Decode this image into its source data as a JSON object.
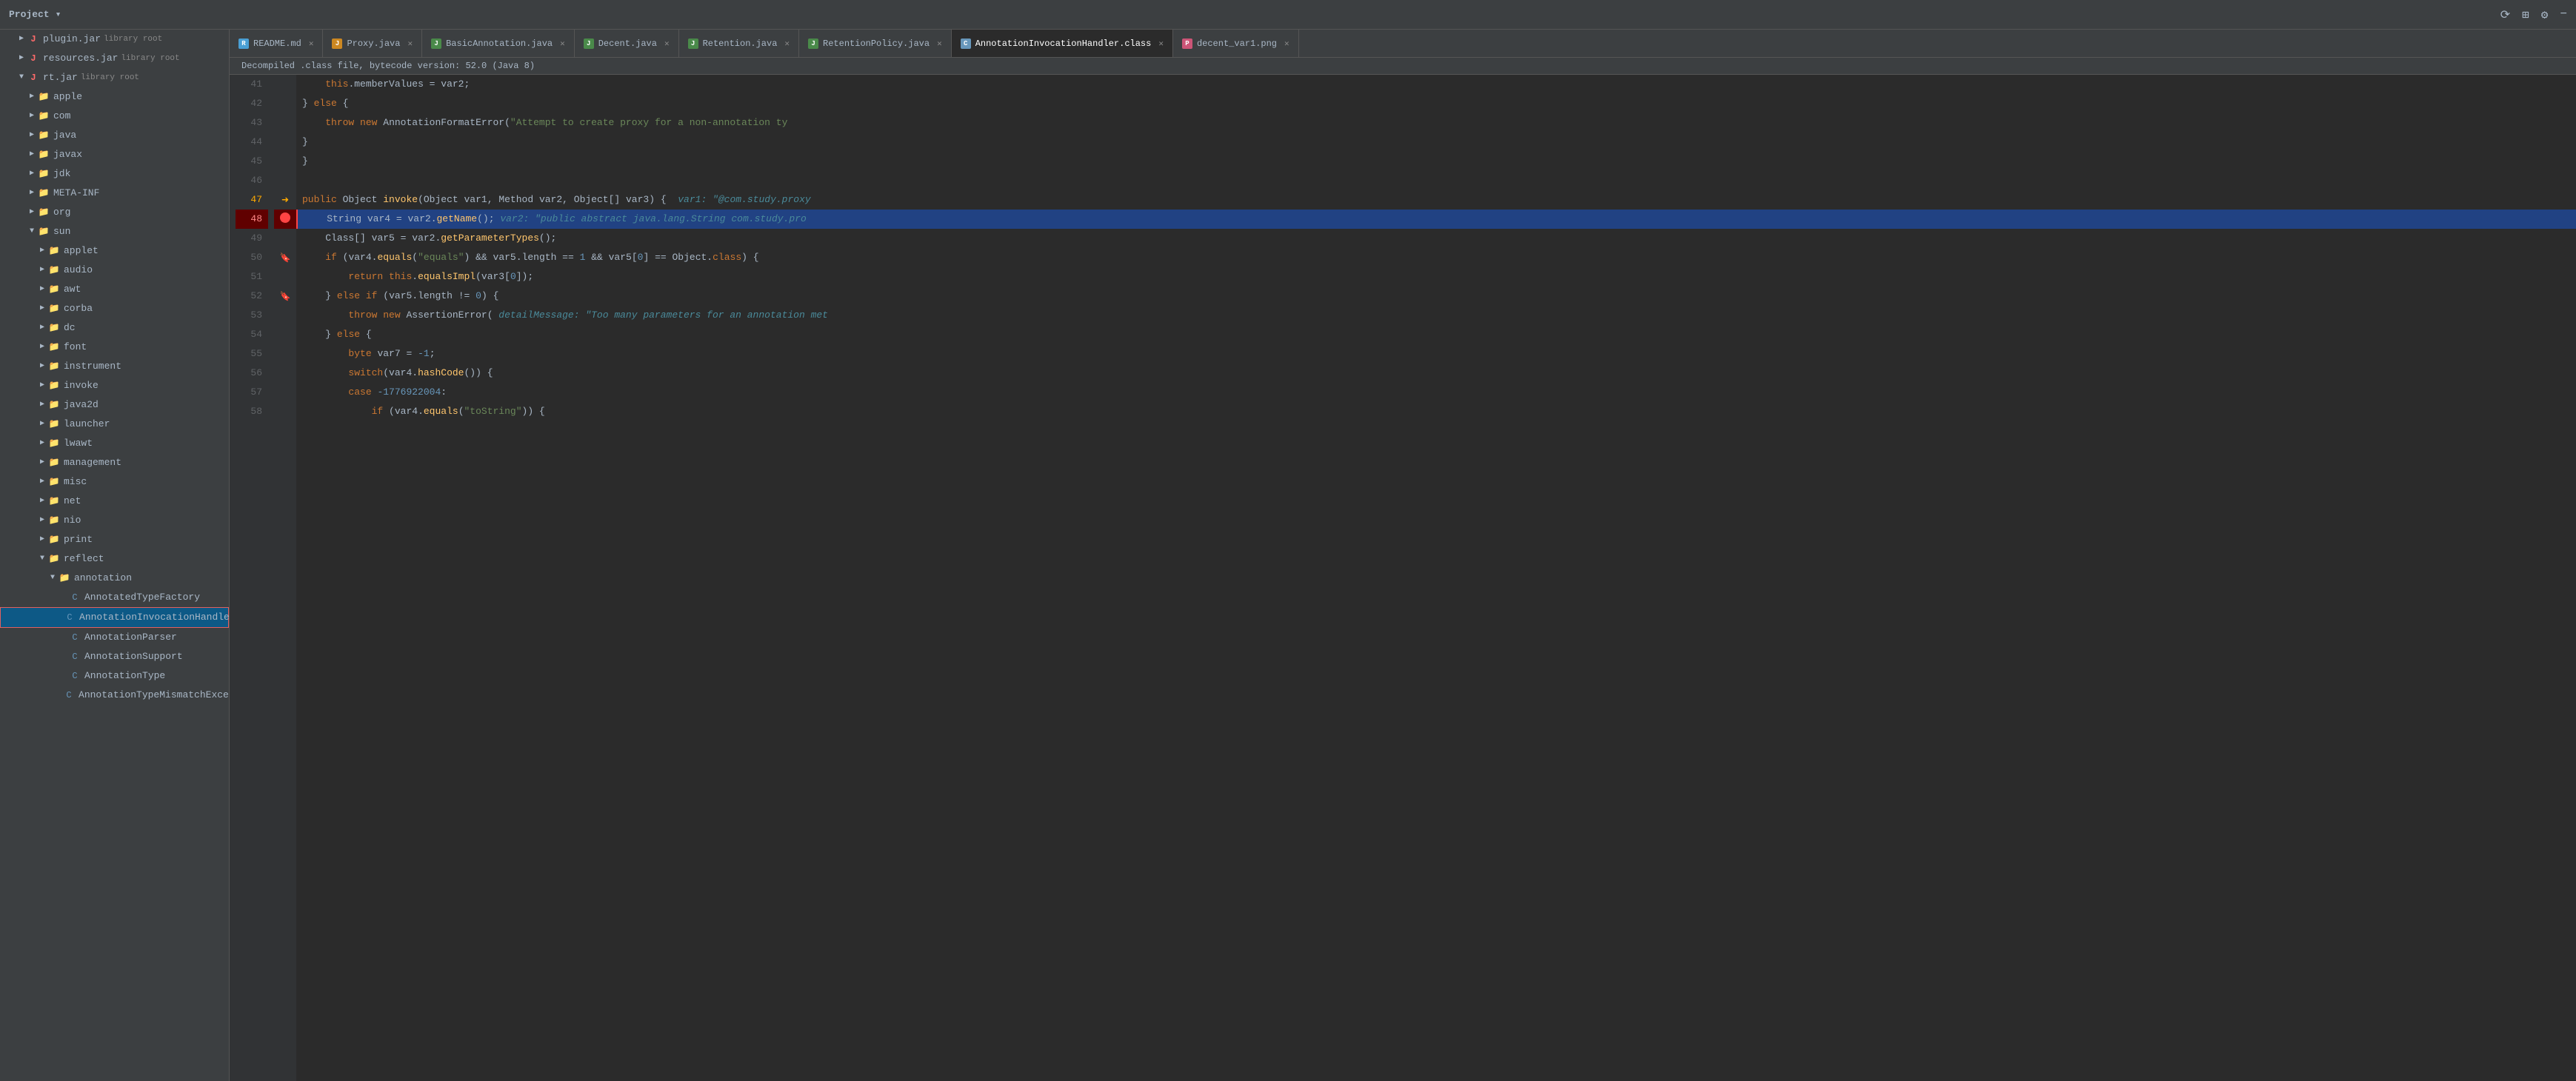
{
  "titlebar": {
    "project_label": "Project",
    "icons": [
      "synchronize",
      "settings",
      "options",
      "minimize"
    ]
  },
  "tabs": [
    {
      "id": "readme",
      "label": "README.md",
      "icon": "readme",
      "active": false,
      "closeable": true
    },
    {
      "id": "proxy",
      "label": "Proxy.java",
      "icon": "java",
      "active": false,
      "closeable": true
    },
    {
      "id": "basic",
      "label": "BasicAnnotation.java",
      "icon": "java-green",
      "active": false,
      "closeable": true
    },
    {
      "id": "decent",
      "label": "Decent.java",
      "icon": "java-green",
      "active": false,
      "closeable": true
    },
    {
      "id": "retention",
      "label": "Retention.java",
      "icon": "java-green",
      "active": false,
      "closeable": true
    },
    {
      "id": "retentionpolicy",
      "label": "RetentionPolicy.java",
      "icon": "java-green",
      "active": false,
      "closeable": true
    },
    {
      "id": "annotationhandler",
      "label": "AnnotationInvocationHandler.class",
      "icon": "class",
      "active": true,
      "closeable": true
    },
    {
      "id": "decent_var",
      "label": "decent_var1.png",
      "icon": "png",
      "active": false,
      "closeable": true
    }
  ],
  "decompile_notice": "Decompiled .class file, bytecode version: 52.0 (Java 8)",
  "sidebar": {
    "items": [
      {
        "label": "plugin.jar",
        "sublabel": "library root",
        "level": 1,
        "type": "jar",
        "expanded": false
      },
      {
        "label": "resources.jar",
        "sublabel": "library root",
        "level": 1,
        "type": "jar",
        "expanded": false
      },
      {
        "label": "rt.jar",
        "sublabel": "library root",
        "level": 1,
        "type": "jar",
        "expanded": true
      },
      {
        "label": "apple",
        "level": 2,
        "type": "folder",
        "expanded": false
      },
      {
        "label": "com",
        "level": 2,
        "type": "folder",
        "expanded": false
      },
      {
        "label": "java",
        "level": 2,
        "type": "folder",
        "expanded": false
      },
      {
        "label": "javax",
        "level": 2,
        "type": "folder",
        "expanded": false
      },
      {
        "label": "jdk",
        "level": 2,
        "type": "folder",
        "expanded": false
      },
      {
        "label": "META-INF",
        "level": 2,
        "type": "folder",
        "expanded": false
      },
      {
        "label": "org",
        "level": 2,
        "type": "folder",
        "expanded": false
      },
      {
        "label": "sun",
        "level": 2,
        "type": "folder",
        "expanded": true
      },
      {
        "label": "applet",
        "level": 3,
        "type": "folder",
        "expanded": false
      },
      {
        "label": "audio",
        "level": 3,
        "type": "folder",
        "expanded": false
      },
      {
        "label": "awt",
        "level": 3,
        "type": "folder",
        "expanded": false
      },
      {
        "label": "corba",
        "level": 3,
        "type": "folder",
        "expanded": false
      },
      {
        "label": "dc",
        "level": 3,
        "type": "folder",
        "expanded": false
      },
      {
        "label": "font",
        "level": 3,
        "type": "folder",
        "expanded": false
      },
      {
        "label": "instrument",
        "level": 3,
        "type": "folder",
        "expanded": false
      },
      {
        "label": "invoke",
        "level": 3,
        "type": "folder",
        "expanded": false
      },
      {
        "label": "java2d",
        "level": 3,
        "type": "folder",
        "expanded": false
      },
      {
        "label": "launcher",
        "level": 3,
        "type": "folder",
        "expanded": false
      },
      {
        "label": "lwawt",
        "level": 3,
        "type": "folder",
        "expanded": false
      },
      {
        "label": "management",
        "level": 3,
        "type": "folder",
        "expanded": false
      },
      {
        "label": "misc",
        "level": 3,
        "type": "folder",
        "expanded": false
      },
      {
        "label": "net",
        "level": 3,
        "type": "folder",
        "expanded": false
      },
      {
        "label": "nio",
        "level": 3,
        "type": "folder",
        "expanded": false
      },
      {
        "label": "print",
        "level": 3,
        "type": "folder",
        "expanded": false
      },
      {
        "label": "reflect",
        "level": 3,
        "type": "folder",
        "expanded": true
      },
      {
        "label": "annotation",
        "level": 4,
        "type": "folder",
        "expanded": true
      },
      {
        "label": "AnnotatedTypeFactory",
        "level": 5,
        "type": "class"
      },
      {
        "label": "AnnotationInvocationHandler",
        "level": 5,
        "type": "class",
        "selected": true
      },
      {
        "label": "AnnotationParser",
        "level": 5,
        "type": "class"
      },
      {
        "label": "AnnotationSupport",
        "level": 5,
        "type": "class"
      },
      {
        "label": "AnnotationType",
        "level": 5,
        "type": "class"
      },
      {
        "label": "AnnotationTypeMismatchExcepti...",
        "level": 5,
        "type": "class"
      }
    ]
  },
  "code": {
    "lines": [
      {
        "num": 41,
        "content": "    this.memberValues = var2;",
        "gutter": ""
      },
      {
        "num": 42,
        "content": "} else {",
        "gutter": ""
      },
      {
        "num": 43,
        "content": "    throw new AnnotationFormatError(\"Attempt to create proxy for a non-annotation ty",
        "gutter": ""
      },
      {
        "num": 44,
        "content": "}",
        "gutter": ""
      },
      {
        "num": 45,
        "content": "}",
        "gutter": ""
      },
      {
        "num": 46,
        "content": "",
        "gutter": ""
      },
      {
        "num": 47,
        "content": "public Object invoke(Object var1, Method var2, Object[] var3) {",
        "gutter": "arrow",
        "hint": "var1: \"@com.study.proxy"
      },
      {
        "num": 48,
        "content": "    String var4 = var2.getName();",
        "gutter": "breakpoint",
        "hint": "var2: \"public abstract java.lang.String com.study.pro",
        "selected": true
      },
      {
        "num": 49,
        "content": "    Class[] var5 = var2.getParameterTypes();",
        "gutter": ""
      },
      {
        "num": 50,
        "content": "    if (var4.equals(\"equals\") && var5.length == 1 && var5[0] == Object.class) {",
        "gutter": "bookmark"
      },
      {
        "num": 51,
        "content": "        return this.equalsImpl(var3[0]);",
        "gutter": ""
      },
      {
        "num": 52,
        "content": "    } else if (var5.length != 0) {",
        "gutter": "bookmark"
      },
      {
        "num": 53,
        "content": "        throw new AssertionError(",
        "gutter": "",
        "hint_label": "detailMessage: \"Too many parameters for an annotation met"
      },
      {
        "num": 54,
        "content": "    } else {",
        "gutter": ""
      },
      {
        "num": 55,
        "content": "        byte var7 = -1;",
        "gutter": ""
      },
      {
        "num": 56,
        "content": "        switch(var4.hashCode()) {",
        "gutter": ""
      },
      {
        "num": 57,
        "content": "        case -1776922004:",
        "gutter": ""
      },
      {
        "num": 58,
        "content": "            if (var4.equals(\"toString\")) {",
        "gutter": ""
      }
    ]
  }
}
